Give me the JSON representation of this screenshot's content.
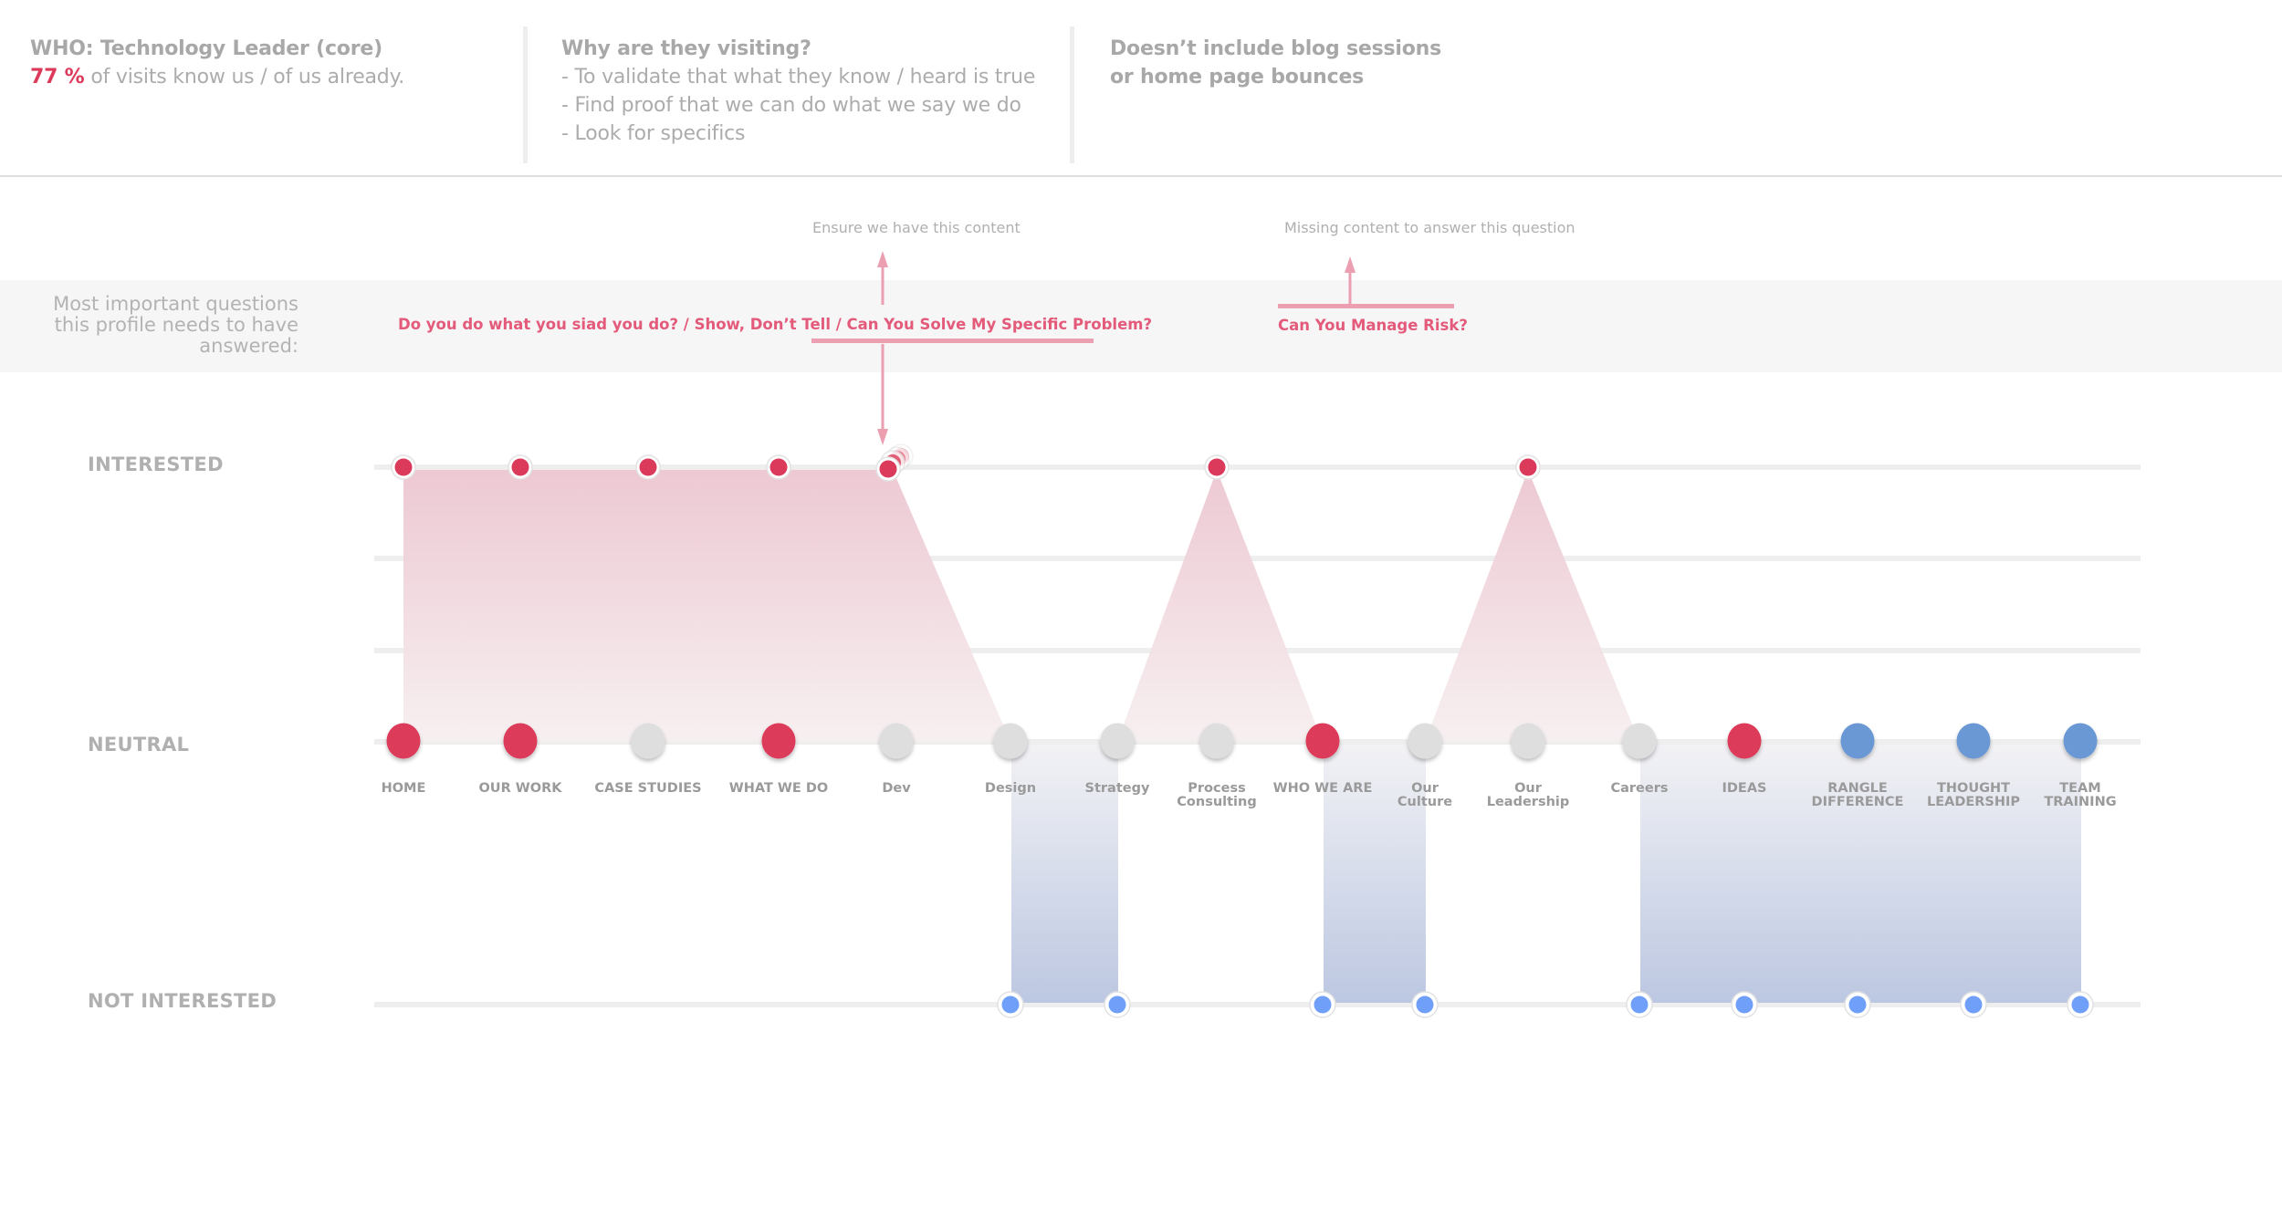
{
  "header": {
    "who": {
      "title": "WHO: Technology Leader (core)",
      "stat_value": "77 %",
      "stat_text": " of visits know us / of us already."
    },
    "why": {
      "title": "Why are they visiting?",
      "items": [
        "- To validate that what they know / heard is true",
        "- Find proof that we can do what we say we do",
        "- Look for specifics"
      ]
    },
    "note": {
      "line1": "Doesn’t include blog sessions",
      "line2": "or home page bounces"
    }
  },
  "questions": {
    "label_lines": [
      "Most important questions",
      "this profile needs to have",
      "answered:"
    ],
    "group1": {
      "prefix": "Do you do what you siad you do? /  Show, Don’t Tell / ",
      "highlight": "Can You Solve My Specific Problem?",
      "annotation": "Ensure we have this content"
    },
    "group2": {
      "highlight": "Can You Manage Risk?",
      "annotation": "Missing content to answer this question"
    }
  },
  "rows": {
    "interested": "INTERESTED",
    "neutral": "NEUTRAL",
    "not_interested": "NOT INTERESTED"
  },
  "colors": {
    "red": "#dc3a5a",
    "grey": "#dedede",
    "blue_large": "#6a98d4",
    "blue_small": "#6f9ff8",
    "pink_fill": "#eec9d2",
    "blue_fill": "#bfcae2",
    "annotation_pink": "#eb9fb1"
  },
  "chart_data": {
    "type": "journey-map",
    "levels": [
      "NOT INTERESTED",
      "NEUTRAL",
      "INTERESTED"
    ],
    "pages": [
      {
        "label": [
          "HOME"
        ],
        "neutral_dot": "red",
        "interest": "interested"
      },
      {
        "label": [
          "OUR WORK"
        ],
        "neutral_dot": "red",
        "interest": "interested"
      },
      {
        "label": [
          "CASE STUDIES"
        ],
        "neutral_dot": "grey",
        "interest": "interested"
      },
      {
        "label": [
          "WHAT WE DO"
        ],
        "neutral_dot": "red",
        "interest": "interested"
      },
      {
        "label": [
          "Dev"
        ],
        "neutral_dot": "grey",
        "interest": "interested",
        "cluster": true
      },
      {
        "label": [
          "Design"
        ],
        "neutral_dot": "grey",
        "interest": "not_interested"
      },
      {
        "label": [
          "Strategy"
        ],
        "neutral_dot": "grey",
        "interest": "not_interested"
      },
      {
        "label": [
          "Process",
          "Consulting"
        ],
        "neutral_dot": "grey",
        "interest": "interested"
      },
      {
        "label": [
          "WHO WE ARE"
        ],
        "neutral_dot": "red",
        "interest": "not_interested"
      },
      {
        "label": [
          "Our",
          "Culture"
        ],
        "neutral_dot": "grey",
        "interest": "not_interested"
      },
      {
        "label": [
          "Our",
          "Leadership"
        ],
        "neutral_dot": "grey",
        "interest": "interested"
      },
      {
        "label": [
          "Careers"
        ],
        "neutral_dot": "grey",
        "interest": "not_interested"
      },
      {
        "label": [
          "IDEAS"
        ],
        "neutral_dot": "red",
        "interest": "not_interested"
      },
      {
        "label": [
          "RANGLE",
          "DIFFERENCE"
        ],
        "neutral_dot": "blue",
        "interest": "not_interested"
      },
      {
        "label": [
          "THOUGHT",
          "LEADERSHIP"
        ],
        "neutral_dot": "blue",
        "interest": "not_interested"
      },
      {
        "label": [
          "TEAM",
          "TRAINING"
        ],
        "neutral_dot": "blue",
        "interest": "not_interested"
      }
    ],
    "pink_regions": [
      [
        0,
        5
      ],
      [
        6,
        7,
        8
      ],
      [
        9,
        10,
        11
      ]
    ],
    "blue_regions": [
      [
        5,
        6
      ],
      [
        8,
        9
      ],
      [
        11,
        15
      ]
    ]
  }
}
